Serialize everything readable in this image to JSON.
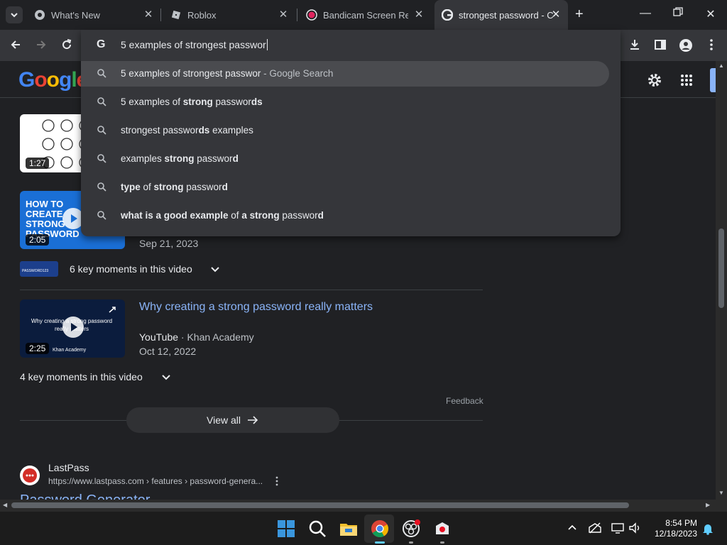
{
  "browser": {
    "tabs": [
      {
        "title": "What's New",
        "active": false
      },
      {
        "title": "Roblox",
        "active": false
      },
      {
        "title": "Bandicam Screen Reco",
        "active": false
      },
      {
        "title": "strongest password - C",
        "active": true
      }
    ],
    "new_tab_label": "+",
    "address_value": "5 examples of strongest passwor",
    "omnibox_letter": "G"
  },
  "suggestions": [
    {
      "parts": [
        [
          "5 examples of strongest passwor",
          false
        ]
      ],
      "suffix": " - Google Search"
    },
    {
      "parts": [
        [
          "5 examples of ",
          false
        ],
        [
          "strong",
          true
        ],
        [
          " passwor",
          false
        ],
        [
          "ds",
          true
        ]
      ],
      "suffix": ""
    },
    {
      "parts": [
        [
          "strongest passwor",
          false
        ],
        [
          "ds",
          true
        ],
        [
          " examples",
          false
        ]
      ],
      "suffix": ""
    },
    {
      "parts": [
        [
          "examples ",
          false
        ],
        [
          "strong",
          true
        ],
        [
          " passwor",
          false
        ],
        [
          "d",
          true
        ]
      ],
      "suffix": ""
    },
    {
      "parts": [
        [
          "type",
          true
        ],
        [
          " of ",
          false
        ],
        [
          "strong",
          true
        ],
        [
          " passwor",
          false
        ],
        [
          "d",
          true
        ]
      ],
      "suffix": ""
    },
    {
      "parts": [
        [
          "what is a good example",
          true
        ],
        [
          " of ",
          false
        ],
        [
          "a strong",
          true
        ],
        [
          " passwor",
          false
        ],
        [
          "d",
          true
        ]
      ],
      "suffix": ""
    }
  ],
  "results": {
    "video1": {
      "duration": "1:27"
    },
    "video2": {
      "duration": "2:05",
      "date": "Sep 21, 2023",
      "key_moments": "6 key moments in this video",
      "thumb_text": "HOW TO CREATE STRONG PASSWORD",
      "logo_text": "PASSWORD123"
    },
    "video3": {
      "duration": "2:25",
      "title": "Why creating a strong password really matters",
      "source": "YouTube",
      "channel": "Khan Academy",
      "date": "Oct 12, 2022",
      "key_moments": "4 key moments in this video",
      "thumb_text": "Why creating a strong password really matters",
      "thumb_brand": "Khan Academy"
    },
    "feedback": "Feedback",
    "view_all": "View all",
    "lastpass": {
      "name": "LastPass",
      "url": "https://www.lastpass.com › features › password-genera...",
      "next_title": "Password Generator"
    }
  },
  "google_logo": "Google",
  "taskbar": {
    "time": "8:54 PM",
    "date": "12/18/2023"
  }
}
